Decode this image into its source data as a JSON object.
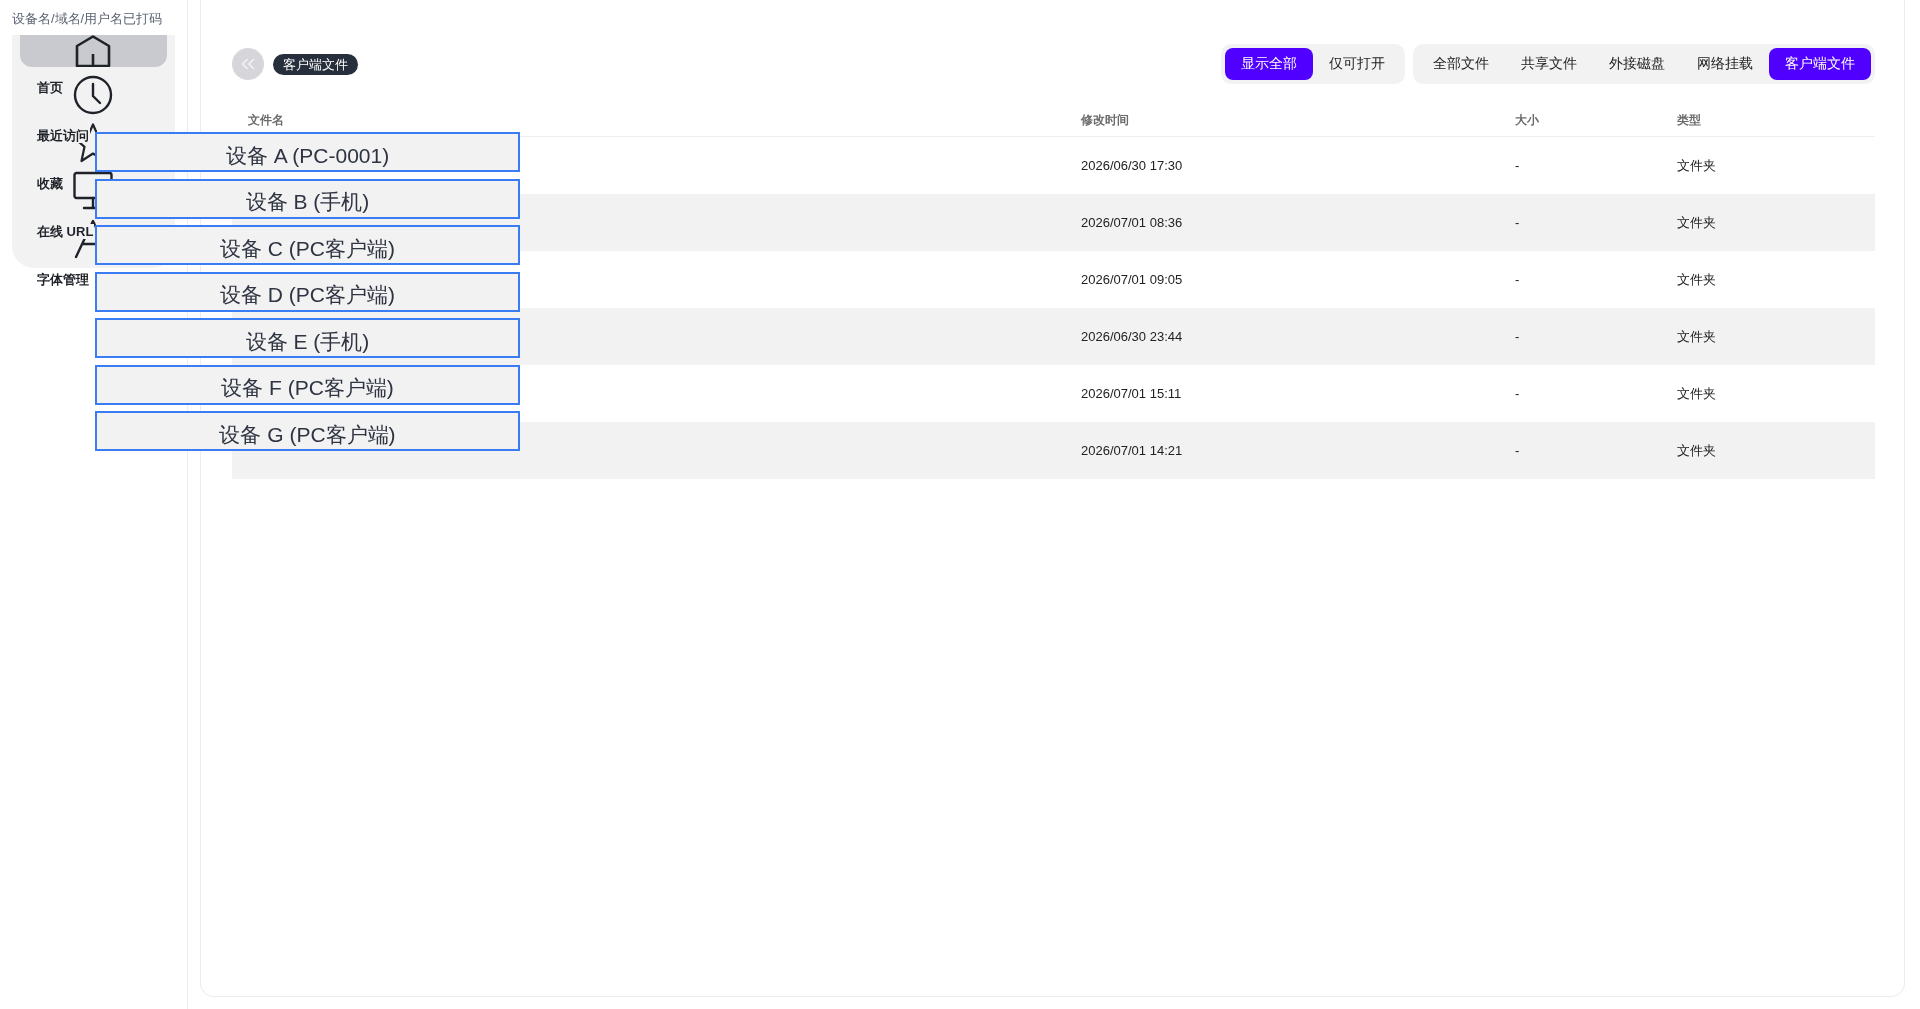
{
  "redaction_note": "设备名/域名/用户名已打码",
  "sidebar": {
    "items": [
      {
        "label": "首页",
        "kind": "home",
        "selected": true
      },
      {
        "label": "最近访问",
        "kind": "clock",
        "selected": false
      },
      {
        "label": "收藏",
        "kind": "star",
        "selected": false
      },
      {
        "label": "在线 URL",
        "kind": "monitor",
        "selected": false
      },
      {
        "label": "字体管理",
        "kind": "font",
        "selected": false
      }
    ]
  },
  "toolbar": {
    "breadcrumb": "客户端文件",
    "view_filter": [
      {
        "label": "显示全部",
        "selected": true
      },
      {
        "label": "仅可打开",
        "selected": false
      }
    ],
    "source_tabs": [
      {
        "label": "全部文件",
        "selected": false
      },
      {
        "label": "共享文件",
        "selected": false
      },
      {
        "label": "外接磁盘",
        "selected": false
      },
      {
        "label": "网络挂载",
        "selected": false
      },
      {
        "label": "客户端文件",
        "selected": true
      }
    ]
  },
  "table": {
    "columns": [
      "文件名",
      "修改时间",
      "大小",
      "类型"
    ],
    "rows": [
      {
        "modified": "2026/06/30 17:30",
        "size": "-",
        "type": "文件夹"
      },
      {
        "modified": "2026/07/01 08:36",
        "size": "-",
        "type": "文件夹"
      },
      {
        "modified": "2026/07/01 09:05",
        "size": "-",
        "type": "文件夹"
      },
      {
        "modified": "2026/06/30 23:44",
        "size": "-",
        "type": "文件夹"
      },
      {
        "modified": "2026/07/01 15:11",
        "size": "-",
        "type": "文件夹"
      },
      {
        "modified": "2026/07/01 14:21",
        "size": "-",
        "type": "文件夹"
      }
    ]
  },
  "redaction_labels": [
    "设备 A (PC-0001)",
    "设备 B (手机)",
    "设备 C (PC客户端)",
    "设备 D (PC客户端)",
    "设备 E (手机)",
    "设备 F (PC客户端)",
    "设备 G (PC客户端)"
  ]
}
